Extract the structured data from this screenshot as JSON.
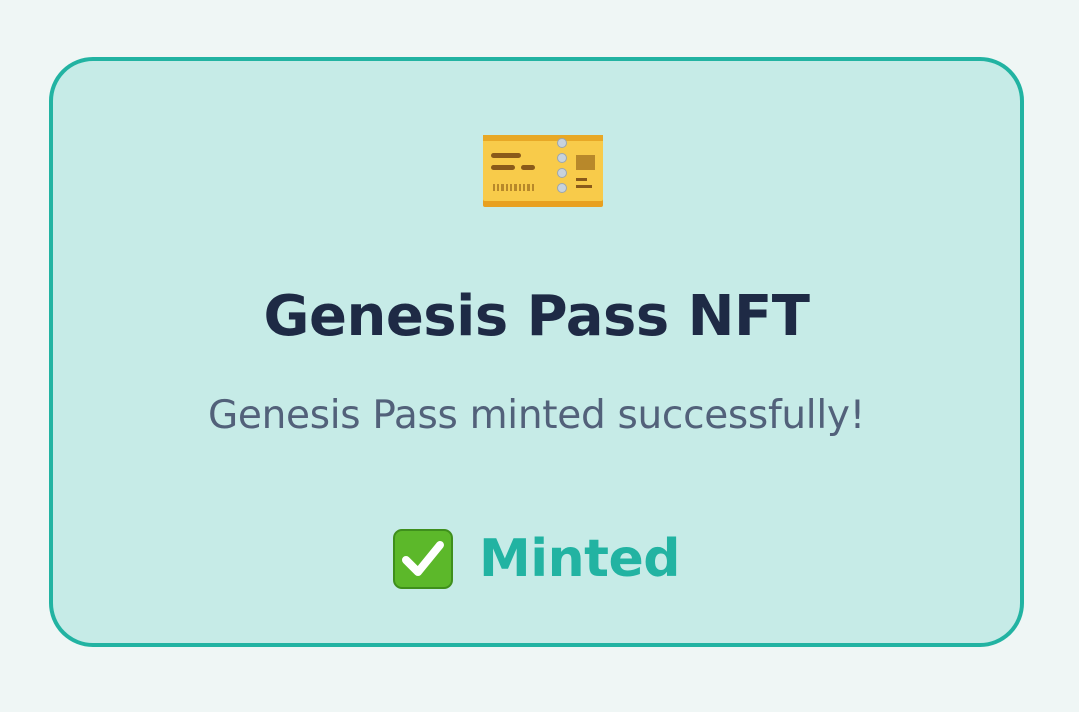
{
  "card": {
    "icon": "ticket-icon",
    "title": "Genesis Pass NFT",
    "message": "Genesis Pass minted successfully!",
    "status": {
      "icon": "check-mark-button-icon",
      "label": "Minted"
    }
  },
  "colors": {
    "background": "#eff6f5",
    "card_background": "#c6ebe7",
    "accent": "#22b3a2",
    "title": "#1e2a45",
    "message": "#52617a"
  }
}
